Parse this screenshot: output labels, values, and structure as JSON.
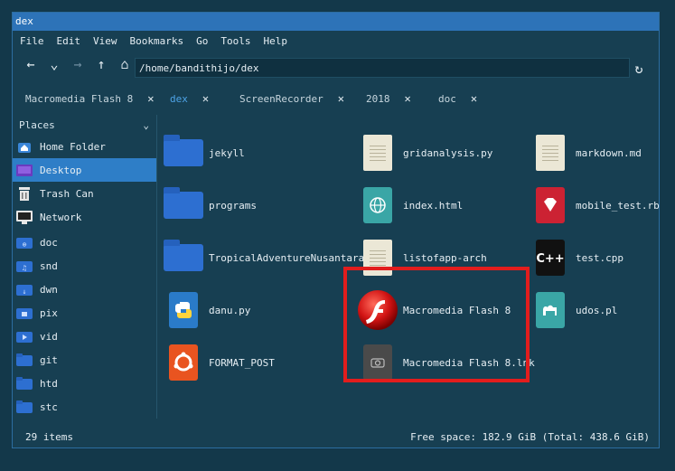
{
  "window": {
    "title": "dex"
  },
  "menu": [
    "File",
    "Edit",
    "View",
    "Bookmarks",
    "Go",
    "Tools",
    "Help"
  ],
  "toolbar": {
    "path": "/home/bandithijo/dex"
  },
  "tabs": [
    {
      "label": "Macromedia Flash 8",
      "active": false
    },
    {
      "label": "dex",
      "active": true
    },
    {
      "label": "ScreenRecorder",
      "active": false
    },
    {
      "label": "2018",
      "active": false
    },
    {
      "label": "doc",
      "active": false
    }
  ],
  "sidebar": {
    "header": "Places",
    "items": [
      {
        "label": "Home Folder",
        "icon": "home-icon",
        "active": false
      },
      {
        "label": "Desktop",
        "icon": "desktop-icon",
        "active": true
      },
      {
        "label": "Trash Can",
        "icon": "trash-icon",
        "active": false
      },
      {
        "label": "Network",
        "icon": "network-icon",
        "active": false
      },
      {
        "label": "doc",
        "icon": "link-folder-icon",
        "active": false
      },
      {
        "label": "snd",
        "icon": "music-folder-icon",
        "active": false
      },
      {
        "label": "dwn",
        "icon": "download-folder-icon",
        "active": false
      },
      {
        "label": "pix",
        "icon": "pictures-folder-icon",
        "active": false
      },
      {
        "label": "vid",
        "icon": "video-folder-icon",
        "active": false
      },
      {
        "label": "git",
        "icon": "folder-icon",
        "active": false
      },
      {
        "label": "htd",
        "icon": "folder-icon",
        "active": false
      },
      {
        "label": "stc",
        "icon": "folder-icon",
        "active": false
      }
    ]
  },
  "files": [
    {
      "name": "jekyll",
      "icon": "folder-icon"
    },
    {
      "name": "gridanalysis.py",
      "icon": "text-file-icon"
    },
    {
      "name": "markdown.md",
      "icon": "markdown-file-icon"
    },
    {
      "name": "programs",
      "icon": "folder-icon"
    },
    {
      "name": "index.html",
      "icon": "html-file-icon"
    },
    {
      "name": "mobile_test.rb",
      "icon": "ruby-file-icon"
    },
    {
      "name": "TropicalAdventureNusantara",
      "icon": "folder-icon"
    },
    {
      "name": "listofapp-arch",
      "icon": "text-file-icon"
    },
    {
      "name": "test.cpp",
      "icon": "cpp-file-icon"
    },
    {
      "name": "danu.py",
      "icon": "python-file-icon"
    },
    {
      "name": "Macromedia Flash 8",
      "icon": "flash-icon"
    },
    {
      "name": "udos.pl",
      "icon": "perl-file-icon"
    },
    {
      "name": "FORMAT_POST",
      "icon": "ubuntu-file-icon"
    },
    {
      "name": "Macromedia Flash 8.lnk",
      "icon": "lnk-file-icon"
    }
  ],
  "status": {
    "items": "29 items",
    "space": "Free space: 182.9 GiB (Total: 438.6 GiB)"
  }
}
